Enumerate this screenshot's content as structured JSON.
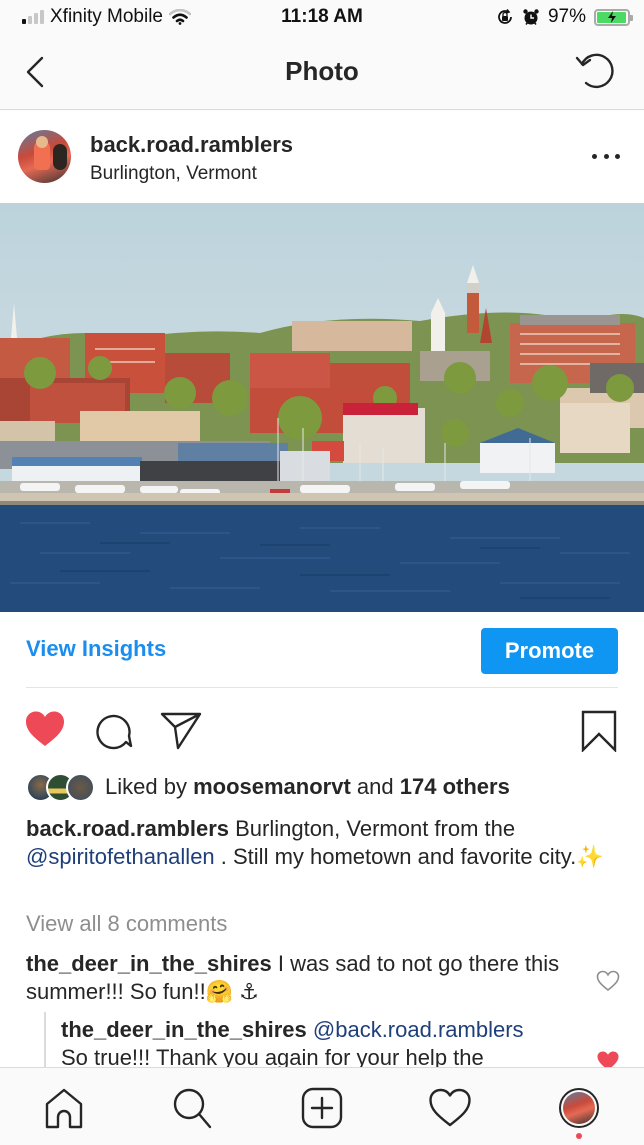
{
  "status_bar": {
    "carrier": "Xfinity Mobile",
    "time": "11:18 AM",
    "battery_percent": "97%",
    "battery_level": 0.97,
    "icons": [
      "signal-icon",
      "wifi-icon",
      "orientation-lock-icon",
      "alarm-icon",
      "battery-charging-icon"
    ]
  },
  "nav": {
    "title": "Photo",
    "back_icon": "chevron-left-icon",
    "refresh_icon": "refresh-icon"
  },
  "post": {
    "username": "back.road.ramblers",
    "location": "Burlington, Vermont",
    "more_icon": "ellipsis-icon",
    "photo_description": "Burlington, Vermont waterfront viewed from Lake Champlain"
  },
  "insights": {
    "view_insights_label": "View Insights",
    "promote_label": "Promote"
  },
  "actions": {
    "liked": true,
    "icons": [
      "heart-filled-icon",
      "comment-icon",
      "share-icon",
      "bookmark-icon"
    ]
  },
  "likes": {
    "prefix": "Liked by ",
    "user": "moosemanorvt",
    "middle": " and ",
    "others": "174 others"
  },
  "caption": {
    "username": "back.road.ramblers",
    "text1": " Burlington, Vermont from the ",
    "mention": "@spiritofethanallen",
    "text2": " . Still my hometown and favorite city.",
    "emoji": "✨"
  },
  "comments": {
    "view_all_label": "View all 8 comments",
    "items": [
      {
        "username": "the_deer_in_the_shires",
        "text": " I was sad to not go there this summer!!! So fun!!",
        "emoji": "🤗 ⚓",
        "liked": false
      }
    ],
    "replies": [
      {
        "username": "the_deer_in_the_shires",
        "mention": " @back.road.ramblers",
        "text": "So true!!! Thank you again for your help the",
        "liked": true
      }
    ]
  },
  "tab_bar": {
    "items": [
      "home-icon",
      "search-icon",
      "new-post-icon",
      "activity-heart-icon",
      "profile-avatar"
    ],
    "profile_notification": true
  },
  "colors": {
    "accent_blue": "#0f95f2",
    "link_blue": "#1a8ef0",
    "mention_navy": "#1f3f7a",
    "like_red": "#ed4956",
    "battery_green": "#4cd964"
  }
}
